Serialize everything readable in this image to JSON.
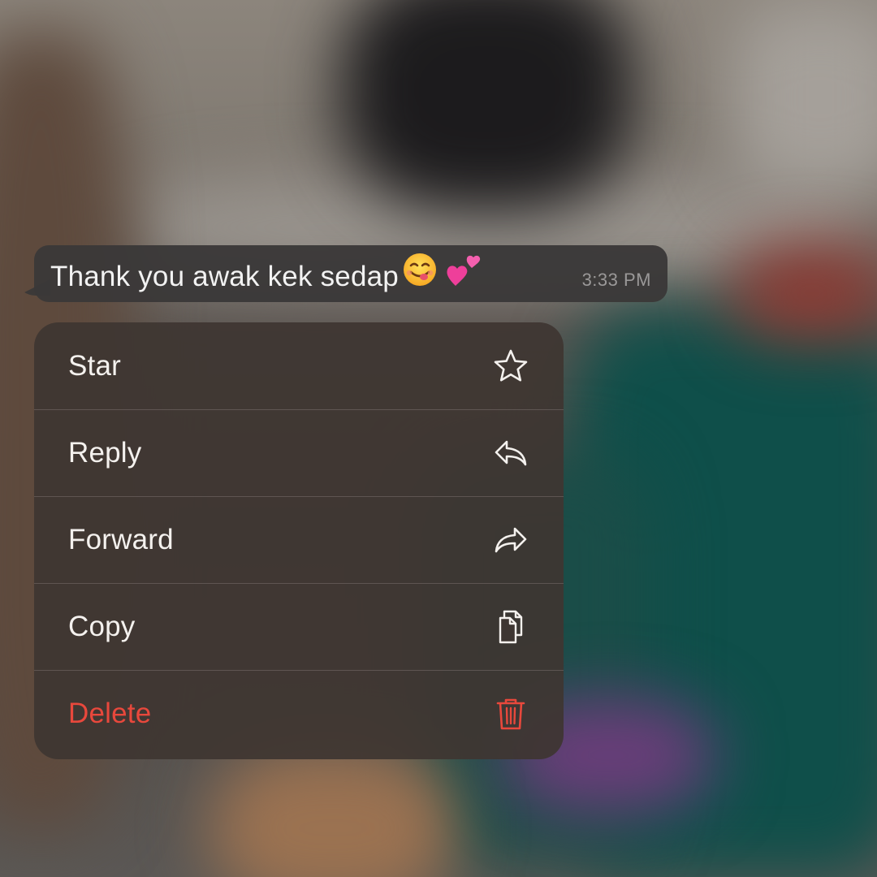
{
  "message": {
    "text": "Thank you awak kek sedap",
    "emojis": [
      "yum-face",
      "two-hearts"
    ],
    "time": "3:33 PM"
  },
  "menu": {
    "items": [
      {
        "label": "Star",
        "icon": "star-icon"
      },
      {
        "label": "Reply",
        "icon": "reply-icon"
      },
      {
        "label": "Forward",
        "icon": "forward-icon"
      },
      {
        "label": "Copy",
        "icon": "copy-icon"
      },
      {
        "label": "Delete",
        "icon": "trash-icon"
      }
    ]
  },
  "colors": {
    "menu_background": "#3e3632",
    "bubble_background": "#3a3838",
    "text_primary": "#f4f1ee",
    "timestamp": "#9a9898",
    "danger": "#e8483c"
  }
}
